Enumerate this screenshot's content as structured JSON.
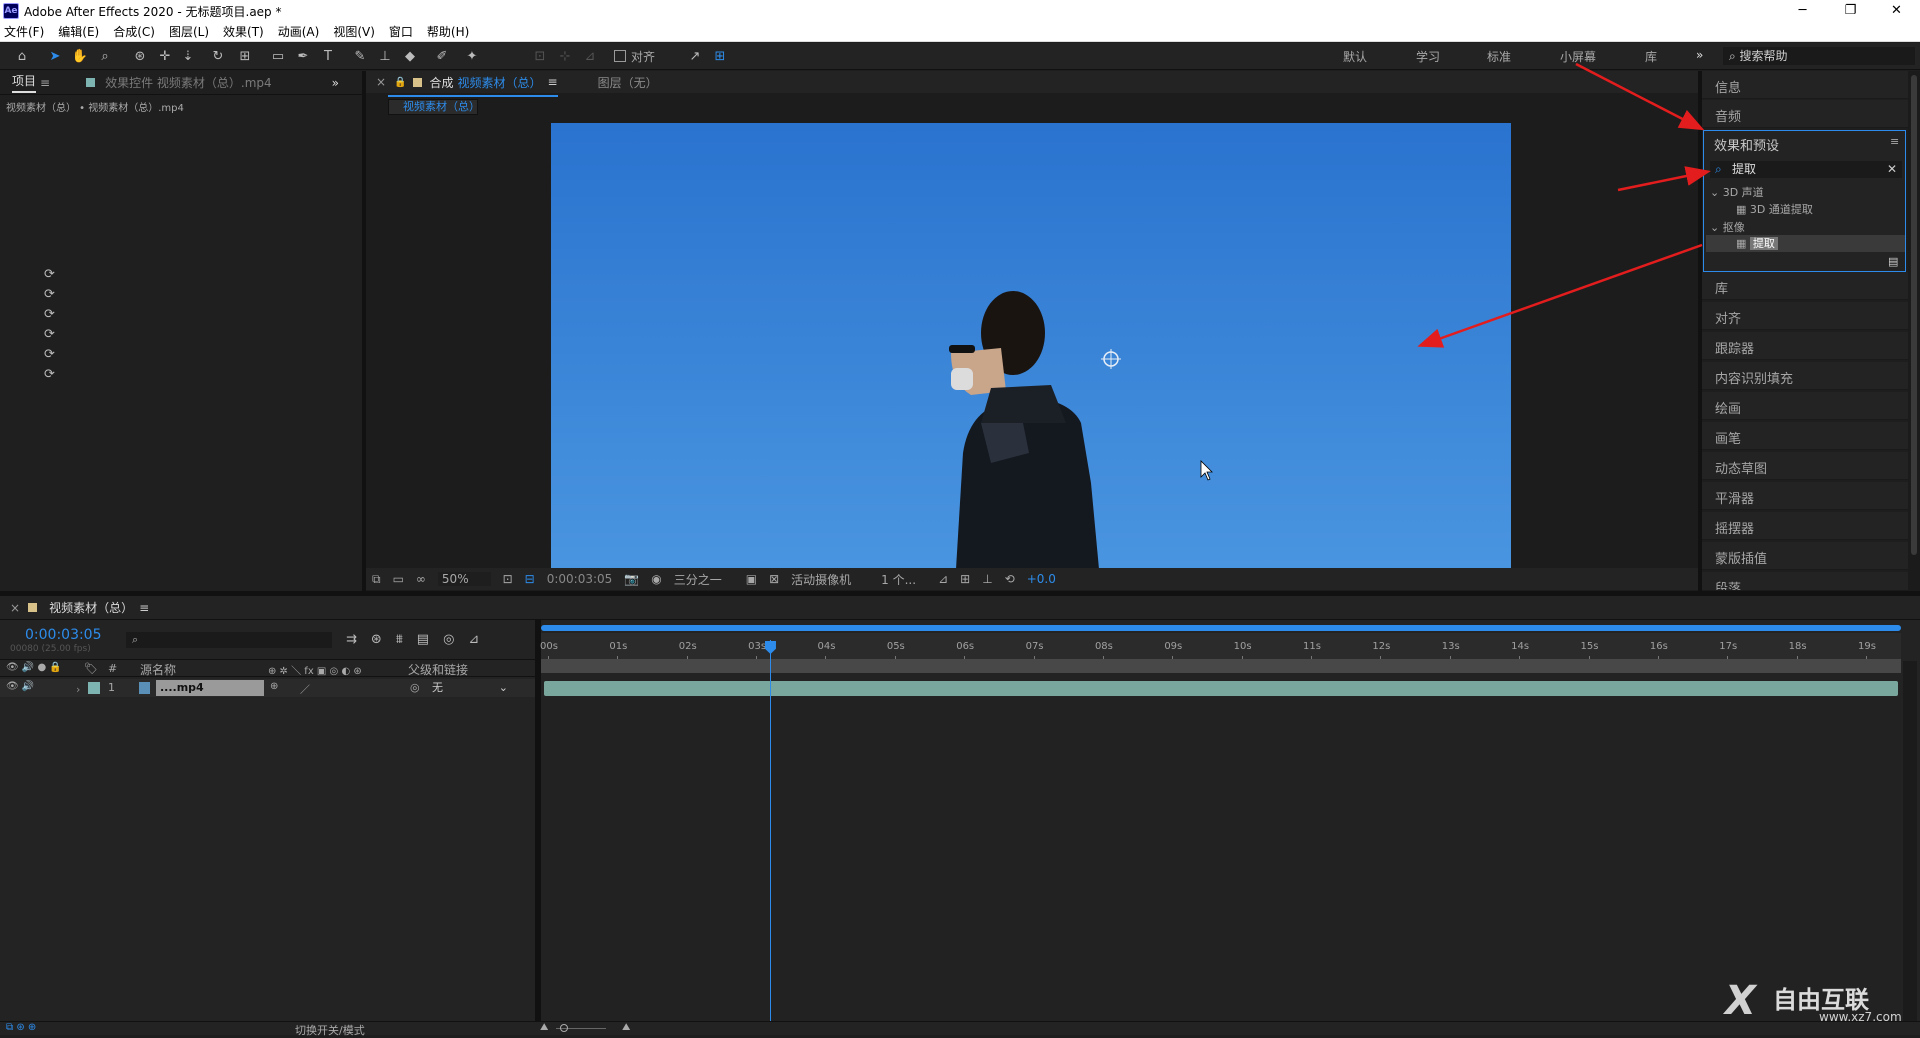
{
  "app": {
    "title": "Adobe After Effects 2020 - 无标题项目.aep *",
    "logo": "Ae"
  },
  "window_controls": {
    "minimize": "─",
    "restore": "❐",
    "close": "✕"
  },
  "menu": [
    "文件(F)",
    "编辑(E)",
    "合成(C)",
    "图层(L)",
    "效果(T)",
    "动画(A)",
    "视图(V)",
    "窗口",
    "帮助(H)"
  ],
  "toolbar": {
    "snap_label": "对齐",
    "workspaces": [
      "默认",
      "学习",
      "标准",
      "小屏幕",
      "库"
    ],
    "more": "»",
    "search_help": "搜索帮助"
  },
  "project_panel": {
    "tab": "项目",
    "menu": "≡",
    "effect_tab": "效果控件 视频素材（总）.mp4",
    "breadcrumb": "视频素材（总） • 视频素材（总）.mp4",
    "expand": "»",
    "reset_icons": 6
  },
  "comp_panel": {
    "close": "×",
    "lock": "🔒",
    "tab_prefix": "合成",
    "tab_name": "视频素材（总）",
    "menu": "≡",
    "layer_tab": "图层（无）",
    "flow_chip": "视频素材（总）",
    "footer": {
      "zoom": "50%",
      "timecode": "0:00:03:05",
      "resolution": "三分之一",
      "camera": "活动摄像机",
      "views": "1 个...",
      "exposure": "+0.0"
    }
  },
  "right_panel": {
    "top_items": [
      "信息",
      "音频"
    ],
    "effects": {
      "title": "效果和预设",
      "menu": "≡",
      "search_value": "提取",
      "clear": "✕",
      "tree": [
        {
          "group": "3D 声道",
          "items": [
            "3D 通道提取"
          ]
        },
        {
          "group": "抠像",
          "items": [
            "提取"
          ]
        }
      ]
    },
    "bottom_items": [
      "库",
      "对齐",
      "跟踪器",
      "内容识别填充",
      "绘画",
      "画笔",
      "动态草图",
      "平滑器",
      "摇摆器",
      "蒙版插值",
      "段落"
    ]
  },
  "timeline": {
    "close": "×",
    "comp_name": "视频素材（总）",
    "menu": "≡",
    "timecode": "0:00:03:05",
    "frame_info": "00080 (25.00 fps)",
    "columns": {
      "num": "#",
      "source_name": "源名称",
      "parent": "父级和链接"
    },
    "layers": [
      {
        "num": "1",
        "name": "....mp4",
        "parent": "无"
      }
    ],
    "ruler": [
      "00s",
      "01s",
      "02s",
      "03s",
      "04s",
      "05s",
      "06s",
      "07s",
      "08s",
      "09s",
      "10s",
      "11s",
      "12s",
      "13s",
      "14s",
      "15s",
      "16s",
      "17s",
      "18s",
      "19s"
    ],
    "playhead_seconds": 3.2,
    "duration_seconds": 19.65,
    "footer": {
      "toggle_label": "切换开关/模式"
    }
  },
  "watermark": {
    "brand": "自由互联",
    "url": "www.xz7.com"
  },
  "colors": {
    "accent": "#2d8ceb",
    "sky": "#3a82d4",
    "track": "#7aa79d",
    "arrow": "#e31d1d"
  }
}
